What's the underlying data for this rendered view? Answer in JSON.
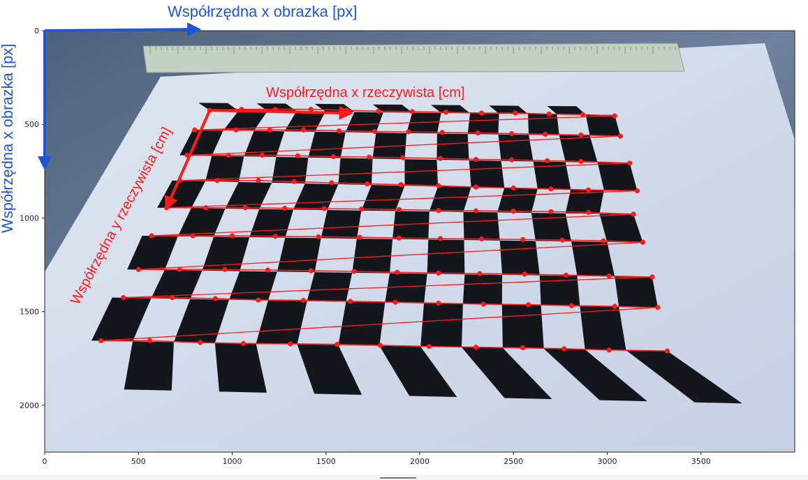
{
  "chart_data": {
    "type": "image",
    "xlim": [
      0,
      4000
    ],
    "ylim": [
      2250,
      0
    ],
    "x_ticks": [
      0,
      500,
      1000,
      1500,
      2000,
      2500,
      3000,
      3500
    ],
    "y_ticks": [
      0,
      500,
      1000,
      1500,
      2000
    ],
    "colors": {
      "image_axes_arrows": "#1f56d6",
      "world_axes_and_corners": "#ff1a1a"
    },
    "annotations": {
      "image_x_axis": "Współrzędna x obrazka [px]",
      "image_y_axis": "Współrzędna x obrazka [px]",
      "world_x_axis": "Współrzędna x rzeczywista [cm]",
      "world_y_axis": "Współrzędna y rzeczywista [cm]"
    },
    "image_axes_arrows": {
      "origin": [
        0,
        0
      ],
      "x_arrow_end": [
        820,
        0
      ],
      "y_arrow_end": [
        0,
        730
      ]
    },
    "world_axes_arrows": {
      "origin": [
        880,
        425
      ],
      "x_arrow_end": [
        1630,
        440
      ],
      "y_arrow_end": [
        650,
        945
      ]
    },
    "detected_corners_rows": [
      [
        [
          880,
          425
        ],
        [
          1050,
          420
        ],
        [
          1230,
          420
        ],
        [
          1420,
          420
        ],
        [
          1610,
          425
        ],
        [
          1780,
          430
        ],
        [
          1960,
          432
        ],
        [
          2140,
          435
        ],
        [
          2330,
          440
        ],
        [
          2510,
          440
        ],
        [
          2690,
          445
        ],
        [
          2870,
          448
        ],
        [
          3040,
          455
        ]
      ],
      [
        [
          800,
          530
        ],
        [
          1020,
          530
        ],
        [
          1200,
          530
        ],
        [
          1380,
          530
        ],
        [
          1570,
          535
        ],
        [
          1760,
          538
        ],
        [
          1940,
          540
        ],
        [
          2120,
          543
        ],
        [
          2310,
          546
        ],
        [
          2490,
          550
        ],
        [
          2670,
          553
        ],
        [
          2860,
          557
        ],
        [
          3070,
          563
        ]
      ],
      [
        [
          760,
          665
        ],
        [
          980,
          665
        ],
        [
          1160,
          665
        ],
        [
          1350,
          668
        ],
        [
          1540,
          672
        ],
        [
          1730,
          675
        ],
        [
          1910,
          678
        ],
        [
          2110,
          682
        ],
        [
          2300,
          687
        ],
        [
          2490,
          690
        ],
        [
          2680,
          694
        ],
        [
          2860,
          698
        ],
        [
          3120,
          707
        ]
      ],
      [
        [
          720,
          800
        ],
        [
          920,
          800
        ],
        [
          1140,
          800
        ],
        [
          1330,
          806
        ],
        [
          1530,
          812
        ],
        [
          1720,
          818
        ],
        [
          1900,
          822
        ],
        [
          2100,
          828
        ],
        [
          2300,
          835
        ],
        [
          2500,
          840
        ],
        [
          2700,
          845
        ],
        [
          2900,
          850
        ],
        [
          3160,
          855
        ]
      ],
      [
        [
          650,
          945
        ],
        [
          860,
          945
        ],
        [
          1070,
          945
        ],
        [
          1280,
          948
        ],
        [
          1490,
          950
        ],
        [
          1690,
          952
        ],
        [
          1890,
          955
        ],
        [
          2100,
          960
        ],
        [
          2300,
          962
        ],
        [
          2500,
          964
        ],
        [
          2700,
          966
        ],
        [
          2900,
          970
        ],
        [
          3140,
          980
        ]
      ],
      [
        [
          570,
          1095
        ],
        [
          790,
          1095
        ],
        [
          1000,
          1095
        ],
        [
          1230,
          1098
        ],
        [
          1460,
          1100
        ],
        [
          1680,
          1103
        ],
        [
          1890,
          1107
        ],
        [
          2110,
          1110
        ],
        [
          2330,
          1112
        ],
        [
          2550,
          1115
        ],
        [
          2760,
          1118
        ],
        [
          2980,
          1122
        ],
        [
          3190,
          1130
        ]
      ],
      [
        [
          500,
          1275
        ],
        [
          720,
          1275
        ],
        [
          960,
          1275
        ],
        [
          1190,
          1278
        ],
        [
          1420,
          1282
        ],
        [
          1650,
          1285
        ],
        [
          1880,
          1290
        ],
        [
          2100,
          1294
        ],
        [
          2320,
          1297
        ],
        [
          2560,
          1300
        ],
        [
          2780,
          1305
        ],
        [
          3010,
          1310
        ],
        [
          3240,
          1315
        ]
      ],
      [
        [
          420,
          1425
        ],
        [
          680,
          1425
        ],
        [
          910,
          1430
        ],
        [
          1140,
          1438
        ],
        [
          1380,
          1440
        ],
        [
          1630,
          1445
        ],
        [
          1870,
          1450
        ],
        [
          2100,
          1455
        ],
        [
          2340,
          1460
        ],
        [
          2580,
          1463
        ],
        [
          2810,
          1468
        ],
        [
          3040,
          1472
        ],
        [
          3270,
          1478
        ]
      ],
      [
        [
          300,
          1655
        ],
        [
          560,
          1655
        ],
        [
          830,
          1665
        ],
        [
          1060,
          1670
        ],
        [
          1310,
          1672
        ],
        [
          1560,
          1675
        ],
        [
          1790,
          1680
        ],
        [
          2050,
          1686
        ],
        [
          2300,
          1690
        ],
        [
          2550,
          1693
        ],
        [
          2770,
          1698
        ],
        [
          3010,
          1705
        ],
        [
          3320,
          1710
        ]
      ]
    ],
    "chessboard": {
      "rows": 10,
      "cols": 14,
      "row_lines_y_left": [
        385,
        425,
        530,
        665,
        800,
        945,
        1095,
        1275,
        1425,
        1655,
        1910
      ],
      "row_lines_x_left": [
        820,
        880,
        790,
        720,
        680,
        600,
        520,
        440,
        360,
        250,
        170
      ],
      "row_lines_y_right": [
        405,
        450,
        563,
        707,
        855,
        980,
        1130,
        1315,
        1478,
        1710,
        1990
      ],
      "row_lines_x_right": [
        2990,
        3040,
        3070,
        3120,
        3160,
        3140,
        3190,
        3240,
        3270,
        3320,
        3720
      ]
    }
  }
}
